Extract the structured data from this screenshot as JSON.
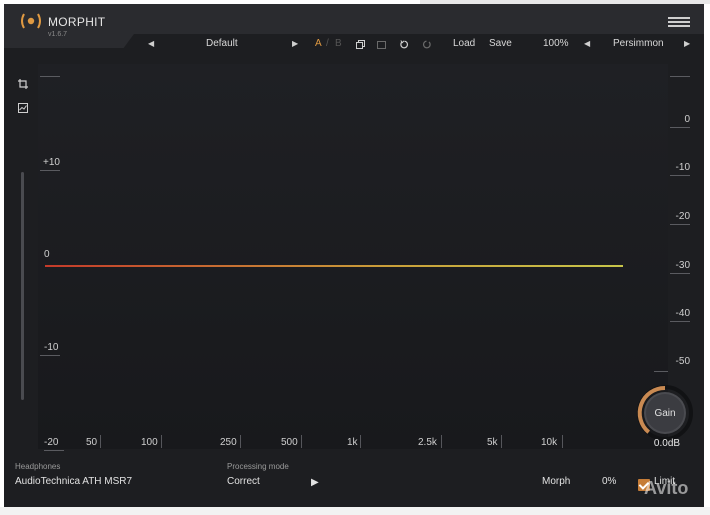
{
  "app": {
    "title": "MORPHIT",
    "version": "v1.6.7"
  },
  "toolbar": {
    "preset": "Default",
    "ab_a": "A",
    "ab_sep": "/",
    "ab_b": "B",
    "load": "Load",
    "save": "Save",
    "zoom": "100%",
    "theme": "Persimmon"
  },
  "plot": {
    "gain_labels": [
      "+10",
      "0",
      "-10",
      "-20"
    ],
    "db_labels": [
      "0",
      "-10",
      "-20",
      "-30",
      "-40",
      "-50"
    ],
    "freq_labels": [
      "50",
      "100",
      "250",
      "500",
      "1k",
      "2.5k",
      "5k",
      "10k"
    ]
  },
  "gain_knob": {
    "label": "Gain",
    "value": "0.0dB"
  },
  "footer": {
    "headphones_label": "Headphones",
    "headphones_value": "AudioTechnica ATH MSR7",
    "processing_label": "Processing mode",
    "processing_value": "Correct",
    "morph_label": "Morph",
    "morph_value": "0%",
    "limit_label": "Limit"
  },
  "watermark": "Avito",
  "colors": {
    "accent": "#e09a42",
    "background": "#1d1e21",
    "header": "#2a2b2f"
  }
}
